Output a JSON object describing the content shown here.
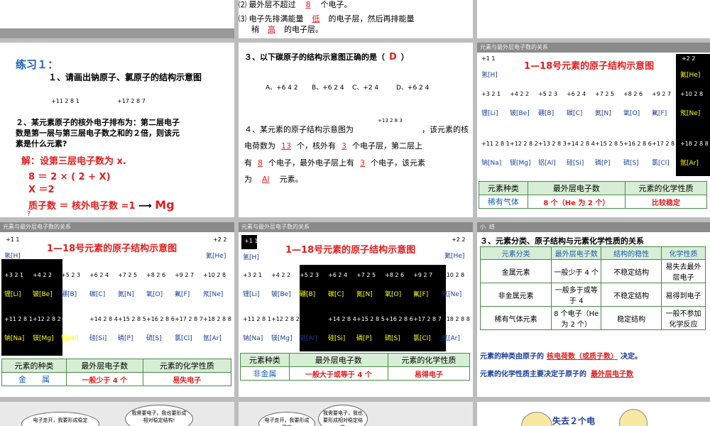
{
  "slide1": {
    "line2": "⑵ 最外层不超过",
    "line2_fill": "8",
    "line2_end": "个电子。",
    "line3": "⑶ 电子先排满能量",
    "line3_fill": "低",
    "line3_end": "的电子层，然后再排能量",
    "line4": "稍",
    "line4_fill": "高",
    "line4_end": "的电子层。"
  },
  "slide2": {
    "title": "练习１：",
    "q1": "１、请画出钠原子、氯原子的结构示意图",
    "na": "+11 2 8 1",
    "cl": "+17 2 8 7",
    "q2a": "２、某元素原子的核外电子排布为：第二层电子",
    "q2b": "数是第一层与第三层电子数之和的２倍，则该元",
    "q2c": "素是什么元素?",
    "sol1": "解：设第三层电子数为 x.",
    "sol2": "8 ＝ 2 × ( 2 + X)",
    "sol3": "X ＝2",
    "sol4": "质子数 ＝ 核外电子数 =1",
    "sol_arrow": "⟶",
    "sol_ans": "Mg",
    "sol5": "?"
  },
  "slide3": {
    "q3": "３、以下碳原子的结构示意图正确的是（",
    "q3_ans": "D",
    "q3_end": "）",
    "opts": [
      "A、+6 4 2",
      "B、+6 2 4",
      "C、+2 4",
      "D、+6 2 4"
    ],
    "q4a": "４、某元素的原子结构示意图为",
    "q4_atom": "+13 2 8 3",
    "q4b": "，该元素的核",
    "q4c": "电荷数为",
    "q4c_fill": "13",
    "q4d": "个，核外有",
    "q4d_fill": "3",
    "q4e": "个电子层，第二层上",
    "q4f": "有",
    "q4f_fill": "8",
    "q4g": "个电子，最外电子层上有",
    "q4g_fill": "3",
    "q4h": "个电子，该元素",
    "q4i": "为",
    "q4i_fill": "Al",
    "q4j": "元素。"
  },
  "periodic": {
    "header": "元素与最外层电子数的关系",
    "title": "1—18号元素的原子结构示意图",
    "names": [
      "氢[H]",
      "氦[He]",
      "锂[Li]",
      "铍[Be]",
      "硼[B]",
      "碳[C]",
      "氮[N]",
      "氧[O]",
      "氟[F]",
      "氖[Ne]",
      "钠[Na]",
      "镁[Mg]",
      "铝[Al]",
      "硅[Si]",
      "磷[P]",
      "硫[S]",
      "氯[Cl]",
      "氩[Ar]"
    ],
    "atoms": [
      "+1 1",
      "+2 2",
      "+3 2 1",
      "+4 2 2",
      "+5 2 3",
      "+6 2 4",
      "+7 2 5",
      "+8 2 6",
      "+9 2 7",
      "+10 2 8",
      "+11 2 8 1",
      "+12 2 8 2",
      "+13 2 8 3",
      "+14 2 8 4",
      "+15 2 8 5",
      "+16 2 8 6",
      "+17 2 8 7",
      "+18 2 8 8"
    ]
  },
  "tableA": {
    "h1": "元素种类",
    "h2": "最外层电子数",
    "h3": "元素的化学性质",
    "c1": "稀有气体",
    "c2": "8 个（He 为 2 个）",
    "c3": "比较稳定"
  },
  "tableB": {
    "h1": "元素的种类",
    "h2": "最外层电子数",
    "h3": "元素的化学性质",
    "c1": "金　　属",
    "c2": "一般少于 4 个",
    "c3": "易失电子"
  },
  "tableC": {
    "h1": "元素种类",
    "h2": "最外层电子数",
    "h3": "元素的化学性质",
    "c1": "非金属",
    "c2": "一般大于或等于 4 个",
    "c3": "易得电子"
  },
  "summary": {
    "header": "小 结",
    "title": "３、元素分类、原子结构与元素化学性质的关系",
    "head": [
      "元素分类",
      "最外层电子数",
      "结构的稳性",
      "化学性质"
    ],
    "rows": [
      [
        "金属元素",
        "一般少于 4 个",
        "不稳定结构",
        "易失去最外层电子"
      ],
      [
        "非金属元素",
        "一般多于或等于 4",
        "不稳定结构",
        "易得到电子"
      ],
      [
        "稀有气体元素",
        "8 个电子（He 为 2 个）",
        "稳定结构",
        "一般不参加化学反应"
      ]
    ],
    "s1": "元素的种类由原子的",
    "s1_fill": "核电荷数（或质子数）",
    "s1_end": "决定。",
    "s2": "元素的化学性质主要决定于原子的",
    "s2_fill": "最外层电子数"
  },
  "bottom": {
    "b1a": "电子走开，我要形成稳定",
    "b1b": "我需要电子。我也要形成相对稳定结构!",
    "b2a": "电子走开，我要形成稳定",
    "b2b": "我需要电子，我也要形成相对稳定结构",
    "b3": "失去２个电"
  }
}
